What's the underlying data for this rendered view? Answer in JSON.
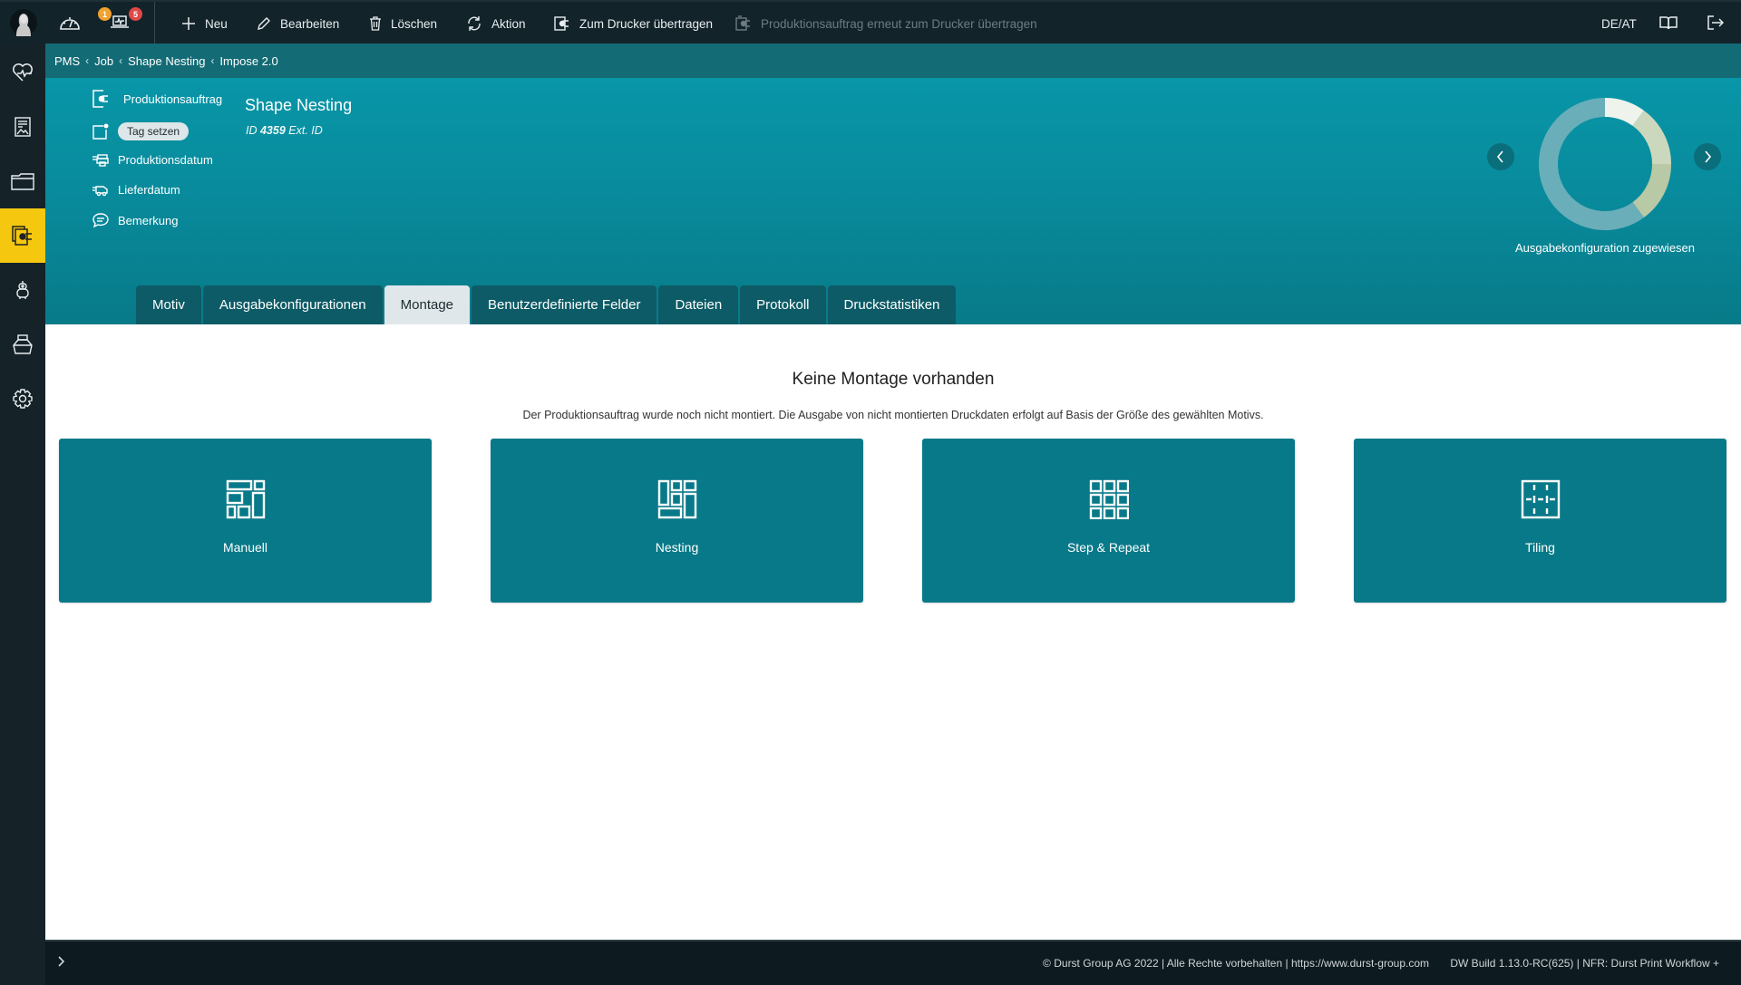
{
  "topbar": {
    "notifications": {
      "warning_count": "1",
      "alert_count": "5"
    },
    "actions": [
      {
        "label": "Neu",
        "icon": "plus-icon",
        "enabled": true
      },
      {
        "label": "Bearbeiten",
        "icon": "pencil-icon",
        "enabled": true
      },
      {
        "label": "Löschen",
        "icon": "trash-icon",
        "enabled": true
      },
      {
        "label": "Aktion",
        "icon": "refresh-icon",
        "enabled": true
      },
      {
        "label": "Zum Drucker übertragen",
        "icon": "send-to-printer-icon",
        "enabled": true
      },
      {
        "label": "Produktionsauftrag erneut zum Drucker übertragen",
        "icon": "resend-to-printer-icon",
        "enabled": false
      }
    ],
    "locale": "DE/AT"
  },
  "sidebar": {
    "items": [
      {
        "name": "health",
        "icon": "heart-pulse-icon",
        "active": false
      },
      {
        "name": "motifs",
        "icon": "image-document-icon",
        "active": false
      },
      {
        "name": "jobs",
        "icon": "folder-icon",
        "active": false
      },
      {
        "name": "production-orders",
        "icon": "production-order-icon",
        "active": true
      },
      {
        "name": "robot",
        "icon": "robot-icon",
        "active": false
      },
      {
        "name": "ink",
        "icon": "ink-bottle-icon",
        "active": false
      },
      {
        "name": "settings",
        "icon": "gear-icon",
        "active": false
      }
    ]
  },
  "breadcrumb": [
    "PMS",
    "Job",
    "Shape Nesting",
    "Impose 2.0"
  ],
  "header": {
    "type_label": "Produktionsauftrag",
    "title": "Shape Nesting",
    "id_prefix": "ID",
    "id_value": "4359",
    "ext_id_label": "Ext. ID",
    "tag_button": "Tag setzen",
    "fields": [
      "Produktionsdatum",
      "Lieferdatum",
      "Bemerkung"
    ],
    "status_donut": {
      "label": "Ausgabekonfiguration zugewiesen",
      "segments": [
        {
          "fraction": 0.1,
          "color": "#eef3ec"
        },
        {
          "fraction": 0.15,
          "color": "#ccd8bd"
        },
        {
          "fraction": 0.15,
          "color": "#b8c9a6"
        },
        {
          "fraction": 0.6,
          "color": "#6aaeb9"
        }
      ]
    }
  },
  "tabs": [
    {
      "label": "Motiv",
      "active": false
    },
    {
      "label": "Ausgabekonfigurationen",
      "active": false
    },
    {
      "label": "Montage",
      "active": true
    },
    {
      "label": "Benutzerdefinierte Felder",
      "active": false
    },
    {
      "label": "Dateien",
      "active": false
    },
    {
      "label": "Protokoll",
      "active": false
    },
    {
      "label": "Druckstatistiken",
      "active": false
    }
  ],
  "content": {
    "title": "Keine Montage vorhanden",
    "subtitle": "Der Produktionsauftrag wurde noch nicht montiert. Die Ausgabe von nicht montierten Druckdaten erfolgt auf Basis der Größe des gewählten Motivs.",
    "cards": [
      {
        "label": "Manuell",
        "icon": "manual-layout-icon"
      },
      {
        "label": "Nesting",
        "icon": "nesting-layout-icon"
      },
      {
        "label": "Step & Repeat",
        "icon": "step-repeat-grid-icon"
      },
      {
        "label": "Tiling",
        "icon": "tiling-icon"
      }
    ]
  },
  "footer": {
    "copyright": "© Durst Group AG 2022 | Alle Rechte vorbehalten | https://www.durst-group.com",
    "build": "DW Build 1.13.0-RC(625)  |  NFR: Durst Print Workflow +"
  },
  "colors": {
    "accent_yellow": "#f5c80f",
    "teal_primary": "#087988",
    "topbar_bg": "#13232a",
    "warning_badge": "#f0a22e",
    "alert_badge": "#e04848"
  }
}
